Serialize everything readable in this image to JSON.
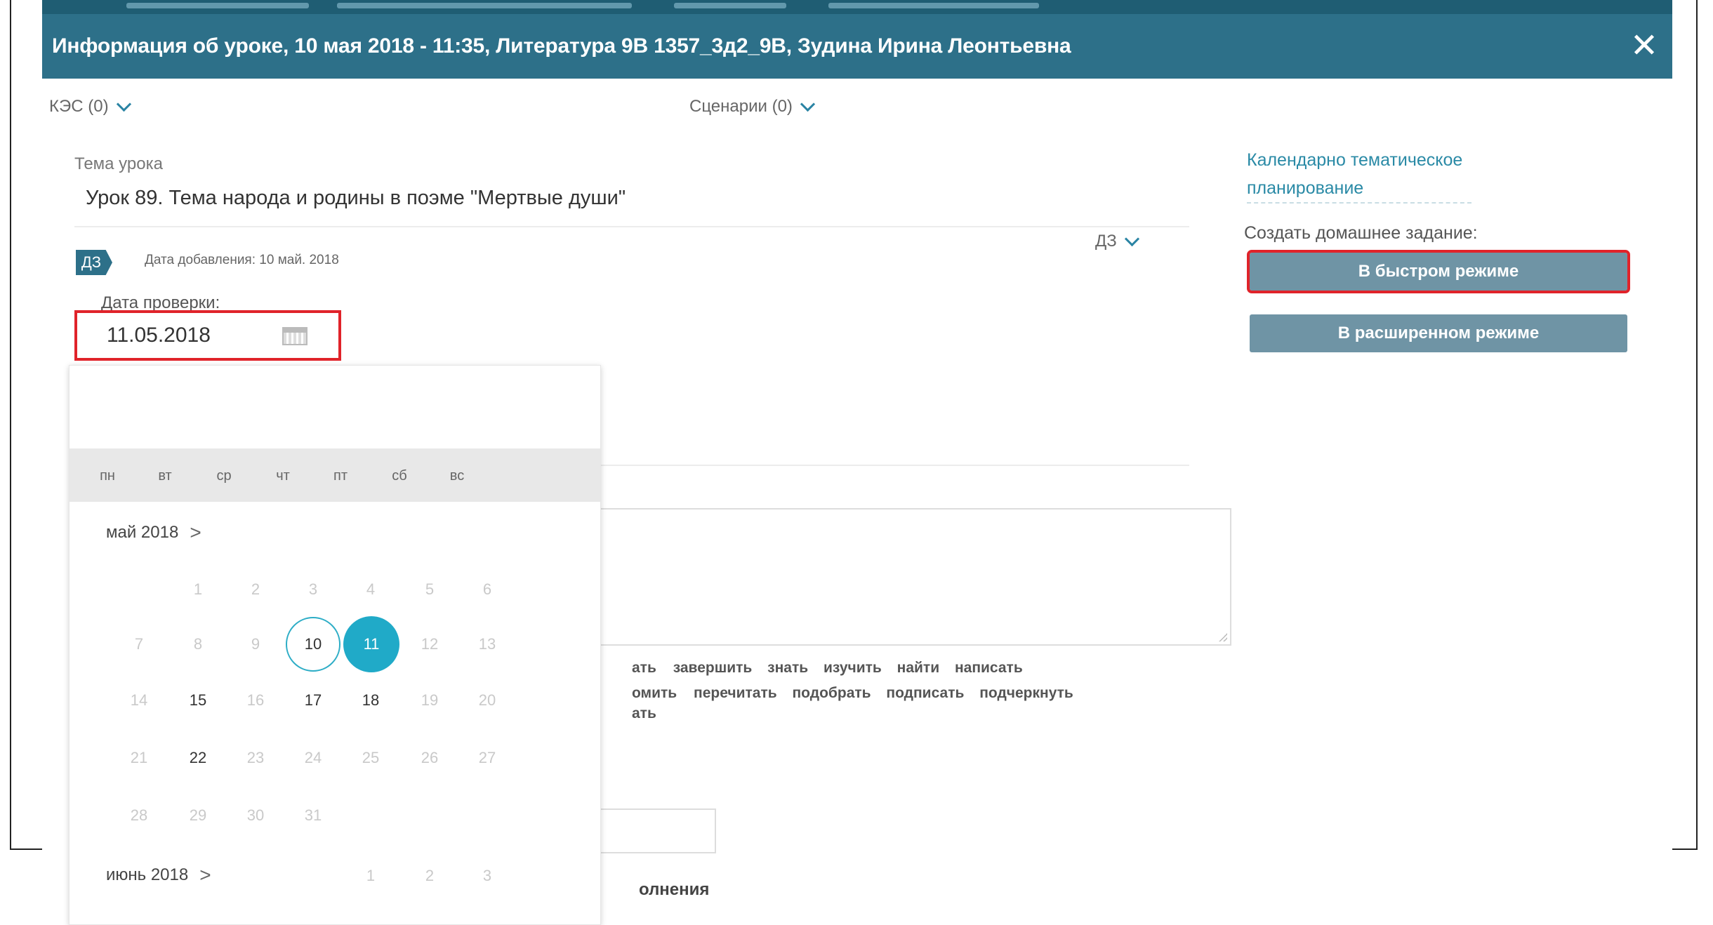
{
  "colors": {
    "header_bg": "#2d7089",
    "accent": "#20aac8",
    "highlight": "#e0232a",
    "button_bg": "#6f94a5"
  },
  "header": {
    "title": "Информация об уроке, 10 мая 2018 - 11:35, Литература 9В 1357_3д2_9В, Зудина Ирина Леонтьевна",
    "close_icon": "✕"
  },
  "toolbar": {
    "kes_label": "КЭС (0)",
    "scenarios_label": "Сценарии (0)",
    "dz_label": "ДЗ"
  },
  "lesson": {
    "topic_label": "Тема урока",
    "topic_value": "Урок 89. Тема народа и родины в поэме \"Мертвые души\"",
    "dz_tag": "ДЗ",
    "added_date": "Дата добавления: 10 май. 2018",
    "check_date_label": "Дата проверки:",
    "check_date_value": "11.05.2018"
  },
  "calendar": {
    "weekdays": [
      "пн",
      "вт",
      "ср",
      "чт",
      "пт",
      "сб",
      "вс"
    ],
    "month1": "май 2018",
    "month2": "июнь 2018",
    "arrow": ">",
    "may_days": [
      [
        "",
        "1",
        "2",
        "3",
        "4",
        "5",
        "6"
      ],
      [
        "7",
        "8",
        "9",
        "10",
        "11",
        "12",
        "13"
      ],
      [
        "14",
        "15",
        "16",
        "17",
        "18",
        "19",
        "20"
      ],
      [
        "21",
        "22",
        "23",
        "24",
        "25",
        "26",
        "27"
      ],
      [
        "28",
        "29",
        "30",
        "31",
        "",
        "",
        ""
      ]
    ],
    "june_days": [
      "1",
      "2",
      "3"
    ],
    "today": "10",
    "selected": "11"
  },
  "verbs": {
    "row1": [
      "ать",
      "завершить",
      "знать",
      "изучить",
      "найти",
      "написать"
    ],
    "row2": [
      "омить",
      "перечитать",
      "подобрать",
      "подписать",
      "подчеркнуть"
    ],
    "row3": [
      "ать"
    ]
  },
  "bottom_text": "олнения",
  "right_panel": {
    "ktp_link": "Календарно тематическое планирование",
    "create_label": "Создать домашнее задание:",
    "fast_button": "В быстром режиме",
    "extended_button": "В расширенном режиме"
  }
}
